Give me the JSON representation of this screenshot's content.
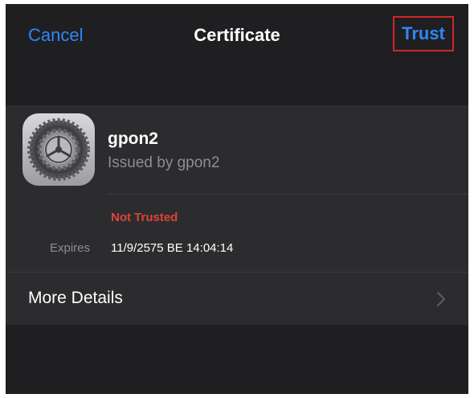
{
  "nav": {
    "cancel_label": "Cancel",
    "title": "Certificate",
    "trust_label": "Trust"
  },
  "certificate": {
    "icon": "settings-gear-icon",
    "name": "gpon2",
    "issued_by": "Issued by gpon2",
    "status": "Not Trusted",
    "expires_label": "Expires",
    "expires_value": "11/9/2575 BE 14:04:14"
  },
  "details": {
    "label": "More Details",
    "icon": "chevron-right-icon"
  },
  "colors": {
    "accent": "#2f86f6",
    "warning": "#e0413b",
    "highlight_box": "#d0252b",
    "background": "#1c1c1e",
    "card": "#2c2c2e"
  }
}
